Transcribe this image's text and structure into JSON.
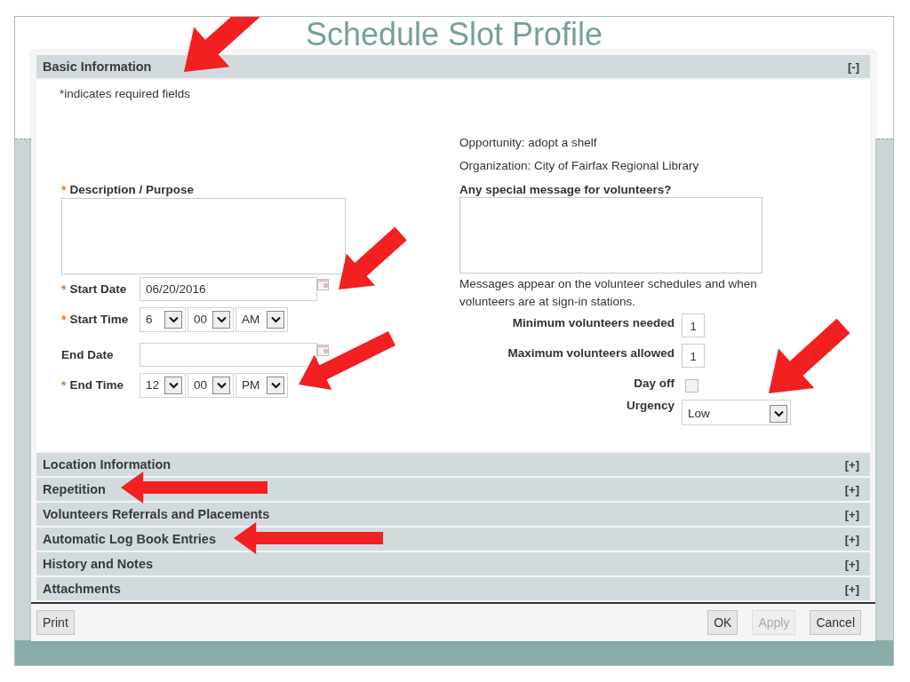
{
  "slide": {
    "title": "Schedule Slot Profile"
  },
  "sections": [
    {
      "title": "Basic Information",
      "toggle": "[-]",
      "body": {
        "required_note": "*indicates required fields",
        "opportunity": "Opportunity: adopt a shelf",
        "organization": "Organization: City of Fairfax Regional Library",
        "left_fields": [
          {
            "kind": "textarea",
            "label": "Description / Purpose",
            "required_mark": "*"
          },
          {
            "kind": "date",
            "label": "Start Date",
            "required_mark": "*",
            "value": "06/20/2016"
          },
          {
            "kind": "time",
            "label": "Start Time",
            "required_mark": "*",
            "hour": "6",
            "minute": "00",
            "period": "AM"
          },
          {
            "kind": "date",
            "label": "End Date"
          },
          {
            "kind": "time",
            "label": "End Time",
            "required_mark": "*",
            "hour": "12",
            "minute": "00",
            "period": "PM"
          }
        ],
        "message": {
          "label": "Any special message for volunteers?",
          "note": "Messages appear on the volunteer schedules and when volunteers are at sign-in stations."
        },
        "right_fields": [
          {
            "kind": "number",
            "label": "Minimum volunteers needed",
            "value": "1"
          },
          {
            "kind": "number",
            "label": "Maximum volunteers allowed",
            "value": "1"
          },
          {
            "kind": "checkbox",
            "label": "Day off",
            "checked": false
          },
          {
            "kind": "select",
            "label": "Urgency",
            "value": "Low"
          }
        ]
      }
    },
    {
      "title": "Location Information",
      "toggle": "[+]"
    },
    {
      "title": "Repetition",
      "toggle": "[+]"
    },
    {
      "title": "Volunteers Referrals and Placements",
      "toggle": "[+]"
    },
    {
      "title": "Automatic Log Book Entries",
      "toggle": "[+]"
    },
    {
      "title": "History and Notes",
      "toggle": "[+]"
    },
    {
      "title": "Attachments",
      "toggle": "[+]"
    }
  ],
  "buttons_left": [
    {
      "label": "Print",
      "disabled": false
    }
  ],
  "buttons_right": [
    {
      "label": "OK",
      "disabled": false
    },
    {
      "label": "Apply",
      "disabled": true
    },
    {
      "label": "Cancel",
      "disabled": false
    }
  ]
}
